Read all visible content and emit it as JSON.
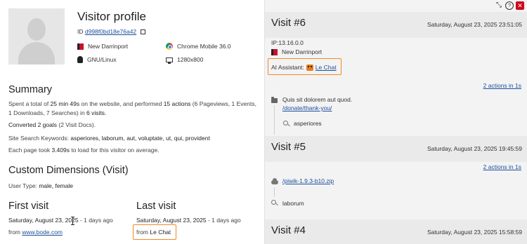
{
  "profile": {
    "title": "Visitor profile",
    "id_label": "ID",
    "id_value": "d998f0bd18e76a42",
    "city": "New Darrinport",
    "browser": "Chrome Mobile 36.0",
    "os": "GNU/Linux",
    "resolution": "1280x800"
  },
  "summary": {
    "heading": "Summary",
    "line1_a": "Spent a total of ",
    "line1_time": "25 min 49s",
    "line1_b": " on the website, and performed ",
    "line1_actions": "15 actions",
    "line1_c": " (6 Pageviews, 1 Events,",
    "line2_a": "1 Downloads, 7 Searches) in ",
    "line2_visits": "6 visits",
    "line2_b": ".",
    "converted_a": "Converted ",
    "converted_goals": "2 goals",
    "converted_b": " (2 Visit Docs).",
    "keywords_label": "Site Search Keywords: ",
    "keywords_value": "asperiores, laborum, aut, voluptate, ut, qui, provident",
    "load_a": "Each page took ",
    "load_time": "3.409s",
    "load_b": " to load for this visitor on average."
  },
  "custom_dimensions": {
    "heading": "Custom Dimensions (Visit)",
    "label": "User Type: ",
    "value": "male, female"
  },
  "first_visit": {
    "heading": "First visit",
    "date": "Saturday, August 23, 2025",
    "ago": " - 1 days ago",
    "from_label": "from ",
    "from_value": "www.bode.com"
  },
  "last_visit": {
    "heading": "Last visit",
    "date": "Saturday, August 23, 2025",
    "ago": " - 1 days ago",
    "from_label": "from ",
    "from_value": "Le Chat"
  },
  "visits": [
    {
      "title": "Visit #6",
      "date": "Saturday, August 23, 2025 23:51:05",
      "ip_label": "IP: ",
      "ip": "13.16.0.0",
      "city": "New Darrinport",
      "ai_label": "AI Assistant: ",
      "ai_value": "Le Chat",
      "actions_link": "2 actions in 1s",
      "action1_title": "Quis sit dolorem aut quod.",
      "action1_url": "/donate/thank-you/",
      "action2_search": "asperiores"
    },
    {
      "title": "Visit #5",
      "date": "Saturday, August 23, 2025 19:45:59",
      "actions_link": "2 actions in 1s",
      "action1_url": "/piwik-1.9.3-b10.zip",
      "action2_search": "laborum"
    },
    {
      "title": "Visit #4",
      "date": "Saturday, August 23, 2025 15:58:59"
    }
  ],
  "window_controls": {
    "minimize": "⤡",
    "help": "?",
    "close": "✕"
  },
  "colors": {
    "link": "#1d4f9c",
    "highlight": "#f08a24",
    "close": "#d0021b",
    "panel_bg": "#f3f3f3"
  }
}
